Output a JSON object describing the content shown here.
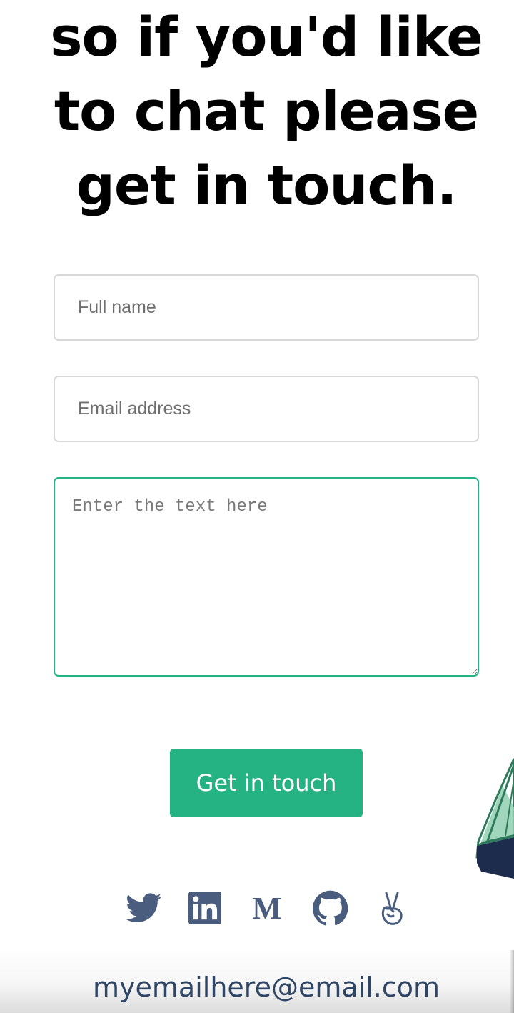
{
  "headline": {
    "lines": [
      "so if you'd like",
      "to chat please",
      "get in touch."
    ]
  },
  "form": {
    "name_placeholder": "Full name",
    "email_placeholder": "Email address",
    "message_placeholder": "Enter the text here",
    "submit_label": "Get in touch"
  },
  "social": {
    "icons": [
      "twitter-icon",
      "linkedin-icon",
      "medium-icon",
      "github-icon",
      "angellist-icon"
    ],
    "icon_color": "#4a5d7e"
  },
  "footer": {
    "email": "myemailhere@email.com"
  },
  "colors": {
    "accent": "#26b383",
    "text_dark": "#000000",
    "link": "#2f4565"
  }
}
